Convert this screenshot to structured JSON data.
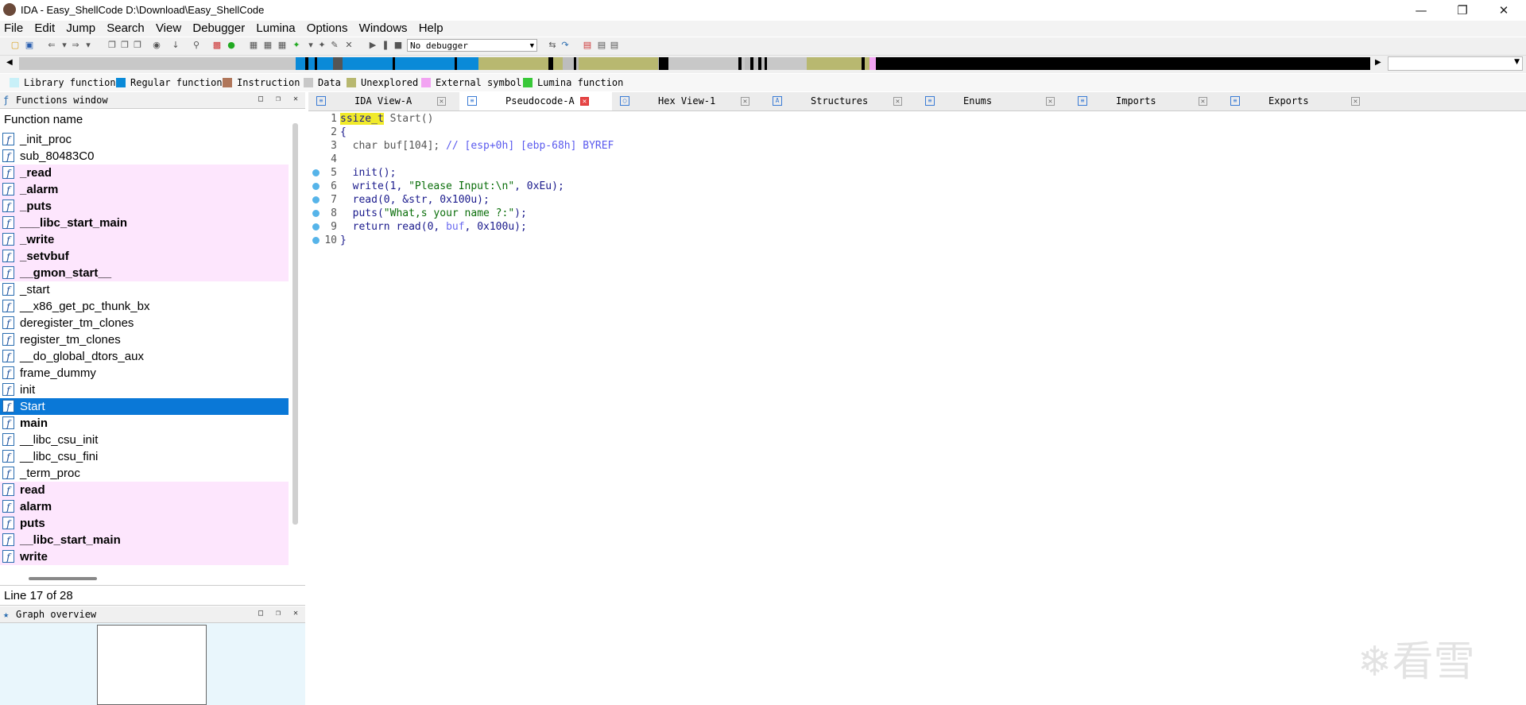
{
  "window": {
    "title": "IDA - Easy_ShellCode D:\\Download\\Easy_ShellCode"
  },
  "menu": [
    "File",
    "Edit",
    "Jump",
    "Search",
    "View",
    "Debugger",
    "Lumina",
    "Options",
    "Windows",
    "Help"
  ],
  "toolbar": {
    "debugger_select": "No debugger"
  },
  "legend": [
    "Library function",
    "Regular function",
    "Instruction",
    "Data",
    "Unexplored",
    "External symbol",
    "Lumina function"
  ],
  "legend_colors": [
    "#c8f0f8",
    "#0a8ad8",
    "#b0765a",
    "#c8c8c8",
    "#b8b870",
    "#f2a3f2",
    "#38c838"
  ],
  "functions_window": {
    "title": "Functions window",
    "column": "Function name",
    "status": "Line 17 of 28",
    "items": [
      {
        "name": "_init_proc",
        "lib": false
      },
      {
        "name": "sub_80483C0",
        "lib": false
      },
      {
        "name": "_read",
        "lib": true
      },
      {
        "name": "_alarm",
        "lib": true
      },
      {
        "name": "_puts",
        "lib": true
      },
      {
        "name": "___libc_start_main",
        "lib": true
      },
      {
        "name": "_write",
        "lib": true
      },
      {
        "name": "_setvbuf",
        "lib": true
      },
      {
        "name": "__gmon_start__",
        "lib": true
      },
      {
        "name": "_start",
        "lib": false
      },
      {
        "name": "__x86_get_pc_thunk_bx",
        "lib": false
      },
      {
        "name": "deregister_tm_clones",
        "lib": false
      },
      {
        "name": "register_tm_clones",
        "lib": false
      },
      {
        "name": "__do_global_dtors_aux",
        "lib": false
      },
      {
        "name": "frame_dummy",
        "lib": false
      },
      {
        "name": "init",
        "lib": false
      },
      {
        "name": "Start",
        "lib": false,
        "selected": true
      },
      {
        "name": "main",
        "lib": false,
        "bold": true
      },
      {
        "name": "__libc_csu_init",
        "lib": false
      },
      {
        "name": "__libc_csu_fini",
        "lib": false
      },
      {
        "name": "_term_proc",
        "lib": false
      },
      {
        "name": "read",
        "lib": true
      },
      {
        "name": "alarm",
        "lib": true
      },
      {
        "name": "puts",
        "lib": true
      },
      {
        "name": "__libc_start_main",
        "lib": true
      },
      {
        "name": "write",
        "lib": true
      }
    ]
  },
  "graph_overview": {
    "title": "Graph overview"
  },
  "tabs": [
    {
      "label": "IDA View-A",
      "active": false
    },
    {
      "label": "Pseudocode-A",
      "active": true
    },
    {
      "label": "Hex View-1",
      "active": false
    },
    {
      "label": "Structures",
      "active": false
    },
    {
      "label": "Enums",
      "active": false
    },
    {
      "label": "Imports",
      "active": false
    },
    {
      "label": "Exports",
      "active": false
    }
  ],
  "code": {
    "line_numbers": [
      "1",
      "2",
      "3",
      "4",
      "5",
      "6",
      "7",
      "8",
      "9",
      "10"
    ],
    "l1_type": "ssize_t",
    "l1_rest": " Start()",
    "l2": "{",
    "l3_a": "  char buf[104]; ",
    "l3_b": "// [esp+0h] [ebp-68h] BYREF",
    "l5": "  init();",
    "l6_a": "  write(1, ",
    "l6_s": "\"Please Input:\\n\"",
    "l6_b": ", 0xEu);",
    "l7": "  read(0, &str, 0x100u);",
    "l8_a": "  puts(",
    "l8_s": "\"What,s your name ?:\"",
    "l8_b": ");",
    "l9_a": "  return read(0, ",
    "l9_v": "buf",
    "l9_b": ", 0x100u);",
    "l10": "}"
  },
  "watermark": "看雪"
}
